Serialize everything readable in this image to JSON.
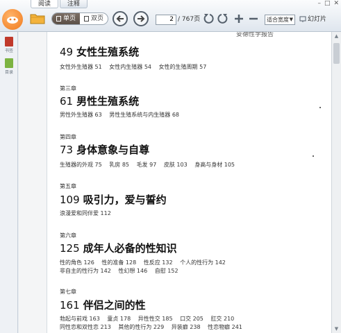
{
  "tabs": [
    {
      "label": "阅读"
    },
    {
      "label": "注释"
    }
  ],
  "toolbar": {
    "view_single": "单页",
    "view_double": "双页",
    "page_current": "2",
    "page_total": "/ 767页",
    "zoom": "适合宽度",
    "slides": "幻灯片"
  },
  "sidebar": {
    "items": [
      {
        "label": "书签"
      },
      {
        "label": "目录"
      }
    ]
  },
  "document": {
    "running_head": "妥德性学报告",
    "chapters": [
      {
        "label": "",
        "num": "49",
        "title": "女性生殖系统",
        "lines": [
          [
            "女性外生殖器 51",
            "女性内生殖器 54",
            "女性的生殖周期 57"
          ]
        ]
      },
      {
        "label": "第三章",
        "num": "61",
        "title": "男性生殖系统",
        "lines": [
          [
            "男性外生殖器 63",
            "男性生殖系统与内生殖器 68"
          ]
        ]
      },
      {
        "label": "第四章",
        "num": "73",
        "title": "身体意象与自尊",
        "lines": [
          [
            "生殖器的外观 75",
            "乳房 85",
            "毛发 97",
            "皮肤 103",
            "身高与身材 105"
          ]
        ]
      },
      {
        "label": "第五章",
        "num": "109",
        "title": "吸引力，爱与誓约",
        "lines": [
          [
            "浪漫爱和同伴爱 112"
          ]
        ]
      },
      {
        "label": "第六章",
        "num": "125",
        "title": "成年人必备的性知识",
        "lines": [
          [
            "性的角色 126",
            "性的准备 128",
            "性反应 132",
            "个人的性行为 142"
          ],
          [
            "非自主的性行为 142",
            "性幻想 146",
            "自慰 152"
          ]
        ]
      },
      {
        "label": "第七章",
        "num": "161",
        "title": "伴侣之间的性",
        "lines": [
          [
            "勃起与前戏 163",
            "童贞 178",
            "异性性交 185",
            "口交 205",
            "肛交 210"
          ],
          [
            "同性恋和双性恋 213",
            "其他的性行为 229",
            "异装癖 238",
            "性恋物癖 241"
          ]
        ]
      }
    ]
  }
}
